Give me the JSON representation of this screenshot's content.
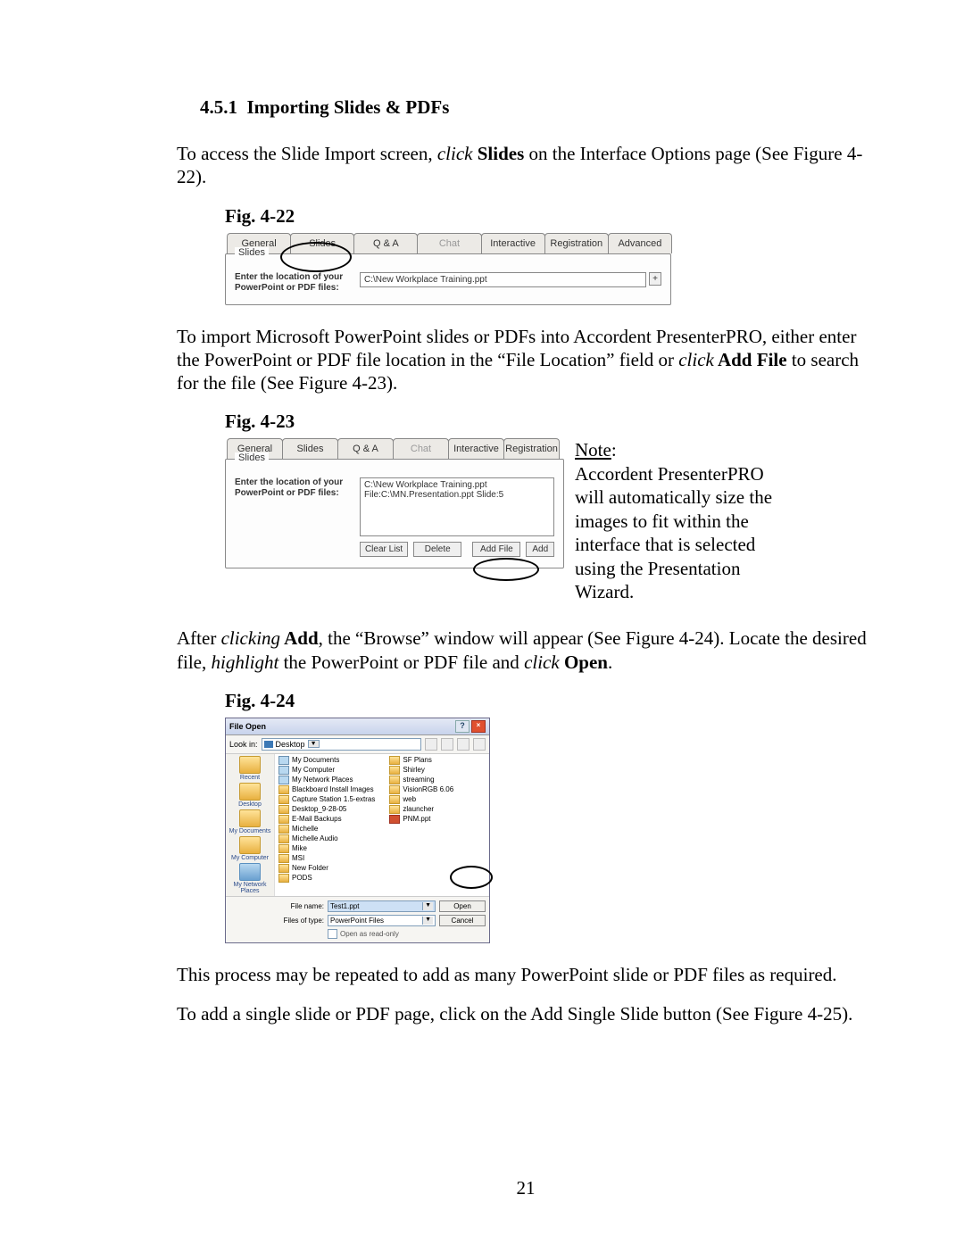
{
  "section": {
    "number": "4.5.1",
    "title": "Importing Slides & PDFs"
  },
  "para1": {
    "lead": "To access the Slide Import screen, ",
    "action_word": "click",
    "bold_word": " Slides",
    "tail": " on the Interface Options page (See Figure 4-22)."
  },
  "fig22": {
    "label": "Fig. 4-22",
    "tabs": [
      "General",
      "Slides",
      "Q & A",
      "Chat",
      "Interactive",
      "Registration",
      "Advanced"
    ],
    "legend": "Slides",
    "field_label": "Enter the location of your PowerPoint or PDF files:",
    "field_value": "C:\\New Workplace Training.ppt",
    "side_button": "+"
  },
  "para2": {
    "lead": "To import Microsoft PowerPoint slides or PDFs into Accordent PresenterPRO, either enter the PowerPoint or PDF file location in the “File Location” field or ",
    "action_word": "click",
    "bold_word": " Add File",
    "tail": " to search for the file (See Figure 4-23)."
  },
  "fig23": {
    "label": "Fig. 4-23",
    "tabs": [
      "General",
      "Slides",
      "Q & A",
      "Chat",
      "Interactive",
      "Registration"
    ],
    "legend": "Slides",
    "field_label": "Enter the location of your PowerPoint or PDF files:",
    "list_text": "C:\\New Workplace Training.ppt\nFile:C:\\MN.Presentation.ppt Slide:5",
    "buttons": {
      "clear": "Clear List",
      "delete": "Delete",
      "addfile": "Add File",
      "add": "Add"
    }
  },
  "note": {
    "label": "Note",
    "colon": ":",
    "body": "Accordent PresenterPRO will automatically size the images to fit within the interface that is selected using the Presentation Wizard."
  },
  "para3": {
    "t1": "After ",
    "i1": "clicking",
    "b1": " Add",
    "t2": ", the “Browse” window will appear (See Figure 4-24).  Locate the desired file, ",
    "i2": "highlight",
    "t3": " the PowerPoint or PDF file and ",
    "i3": "click",
    "b2": " Open",
    "t4": "."
  },
  "fig24": {
    "label": "Fig. 4-24",
    "title": "File Open",
    "lookin_label": "Look in:",
    "lookin_value": "Desktop",
    "places": [
      "Recent",
      "Desktop",
      "My Documents",
      "My Computer",
      "My Network Places"
    ],
    "col1": [
      "My Documents",
      "My Computer",
      "My Network Places",
      "Blackboard Install Images",
      "Capture Station 1.5-extras",
      "Desktop_9-28-05",
      "E-Mail Backups",
      "Michelle",
      "Michelle Audio",
      "Mike",
      "MSI",
      "New Folder",
      "PODS"
    ],
    "col1_kind": [
      "sys",
      "sys",
      "sys",
      "f",
      "f",
      "f",
      "f",
      "f",
      "f",
      "f",
      "f",
      "f",
      "f"
    ],
    "col2": [
      "SF Plans",
      "Shirley",
      "streaming",
      "VisionRGB 6.06",
      "web",
      "zlauncher",
      "PNM.ppt"
    ],
    "col2_kind": [
      "f",
      "f",
      "f",
      "f",
      "f",
      "f",
      "ppt"
    ],
    "filename_label": "File name:",
    "filename_value": "Test1.ppt",
    "type_label": "Files of type:",
    "type_value": "PowerPoint Files",
    "open": "Open",
    "cancel": "Cancel",
    "readonly": "Open as read-only"
  },
  "para4": "This process may be repeated to add as many PowerPoint slide or PDF files as required.",
  "para5": "To add a single slide or PDF page, click on the Add Single Slide button (See Figure 4-25).",
  "pagenum": "21"
}
